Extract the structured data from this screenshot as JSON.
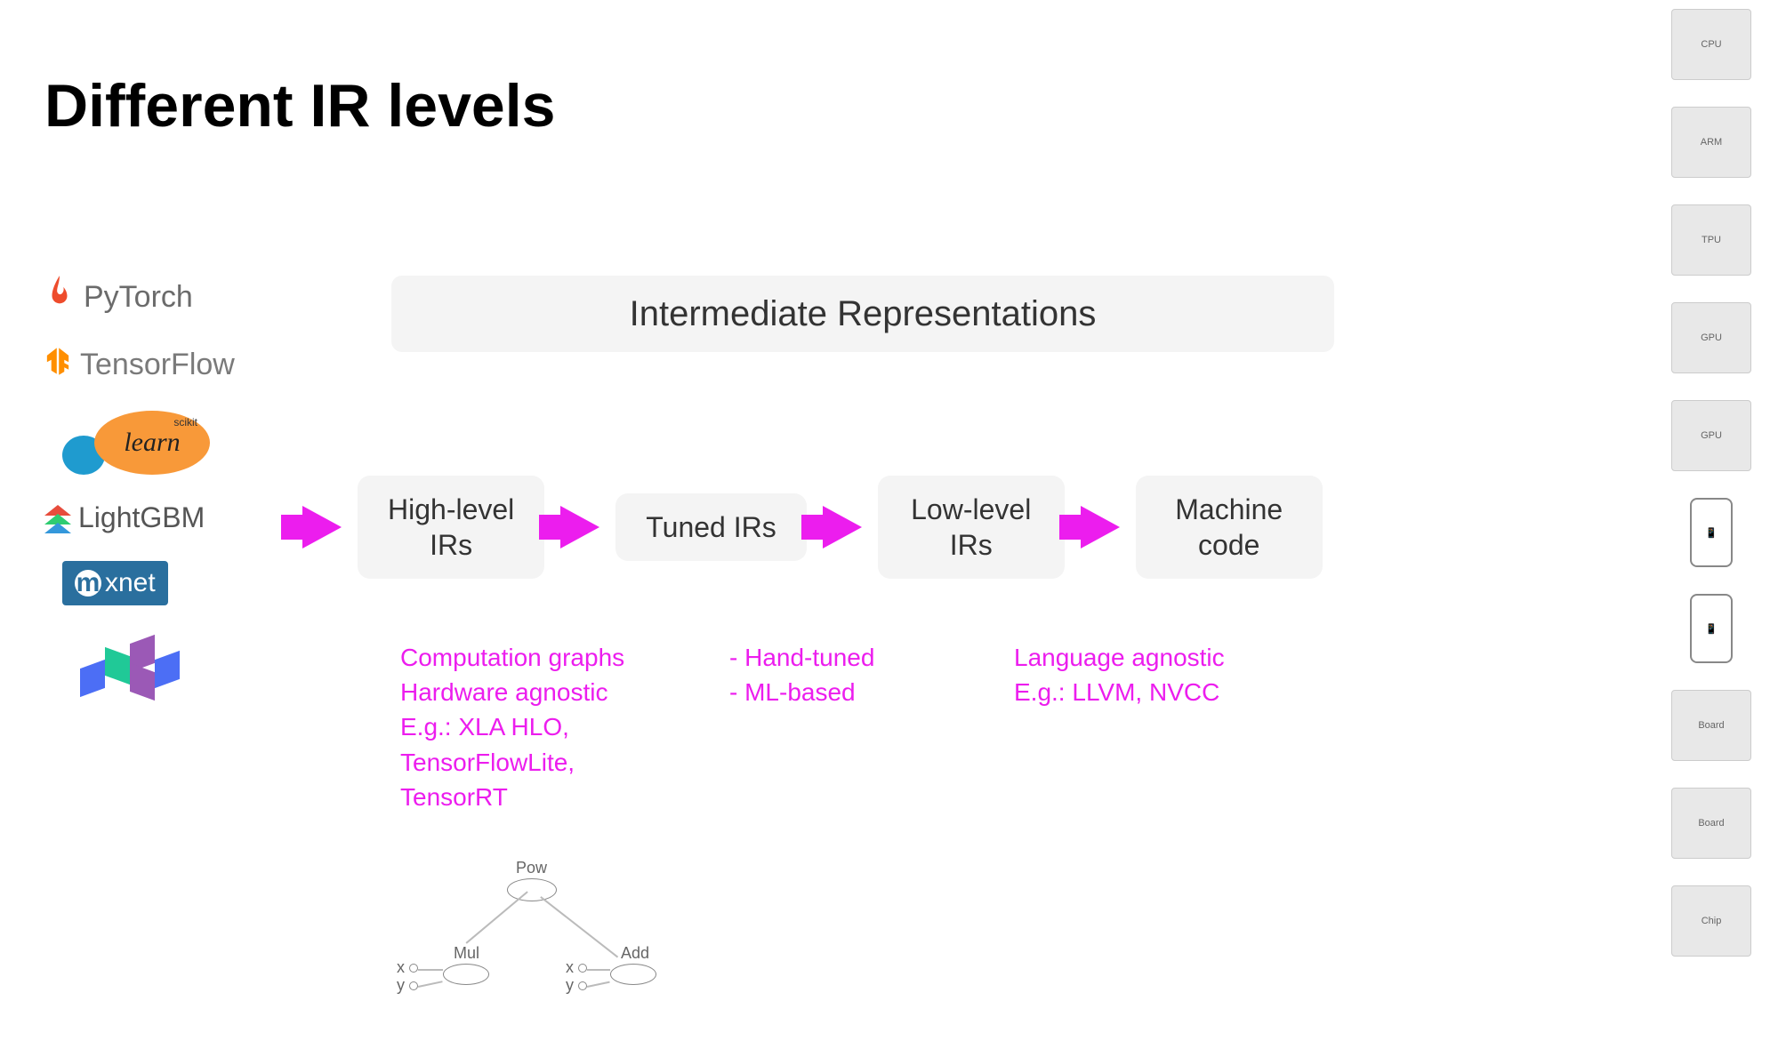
{
  "title": "Different IR levels",
  "frameworks": {
    "pytorch": "PyTorch",
    "tensorflow": "TensorFlow",
    "sklearn_small": "scikit",
    "sklearn_large": "learn",
    "lightgbm": "LightGBM",
    "mxnet": "xnet",
    "mxnet_m": "m",
    "jax": "JAX"
  },
  "ir_header": "Intermediate Representations",
  "boxes": {
    "high": "High-level\nIRs",
    "tuned": "Tuned IRs",
    "low": "Low-level\nIRs",
    "machine": "Machine\ncode"
  },
  "annotations": {
    "high": [
      "Computation graphs",
      "Hardware agnostic",
      "E.g.: XLA HLO,",
      "TensorFlowLite,",
      "TensorRT"
    ],
    "tuned": [
      "- Hand-tuned",
      "- ML-based"
    ],
    "low": [
      "Language agnostic",
      "E.g.: LLVM, NVCC"
    ]
  },
  "graph": {
    "pow": "Pow",
    "mul": "Mul",
    "add": "Add",
    "x": "x",
    "y": "y"
  },
  "hardware": [
    "CPU",
    "ARM",
    "TPU",
    "GPU",
    "GPU",
    "📱",
    "📱",
    "Board",
    "Board",
    "Chip"
  ]
}
